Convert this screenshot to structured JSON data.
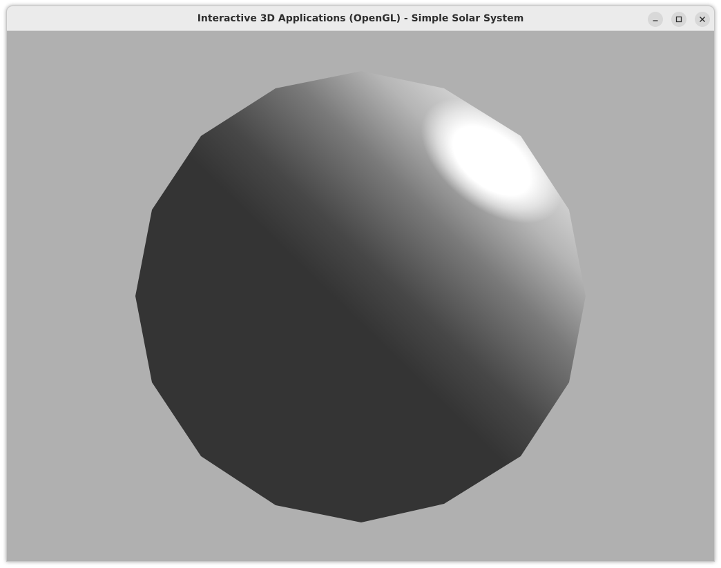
{
  "window": {
    "title": "Interactive 3D Applications (OpenGL) - Simple Solar System",
    "controls": {
      "minimize_icon": "minimize-icon",
      "maximize_icon": "maximize-icon",
      "close_icon": "close-icon"
    }
  },
  "scene": {
    "background_color": "#b0b0b0",
    "object": "sphere",
    "sphere_dark_color": "#343434",
    "sphere_highlight_color": "#ffffff"
  }
}
